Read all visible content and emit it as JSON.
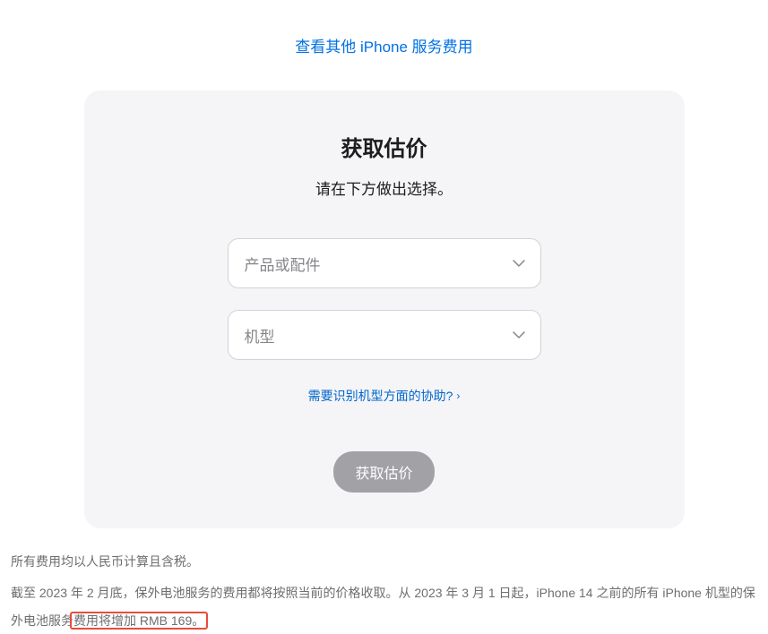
{
  "topLink": "查看其他 iPhone 服务费用",
  "card": {
    "title": "获取估价",
    "subtitle": "请在下方做出选择。",
    "select1Placeholder": "产品或配件",
    "select2Placeholder": "机型",
    "helpLink": "需要识别机型方面的协助?",
    "submitLabel": "获取估价"
  },
  "footer": {
    "line1": "所有费用均以人民币计算且含税。",
    "line2a": "截至 2023 年 2 月底，保外电池服务的费用都将按照当前的价格收取。从 2023 年 3 月 1 日起，iPhone 14 之前的所有 iPhone 机型的保外电池服务",
    "line2highlight": "费用将增加 RMB 169。"
  }
}
